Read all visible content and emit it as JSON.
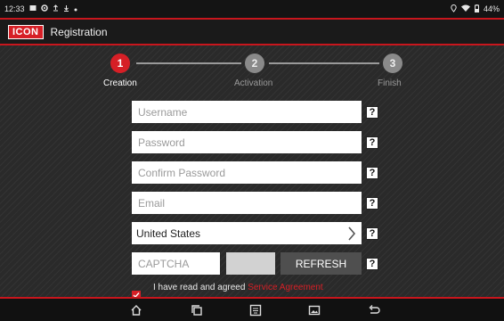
{
  "status_bar": {
    "time": "12:33",
    "battery": "44%"
  },
  "app_bar": {
    "logo_text": "ICON",
    "title": "Registration"
  },
  "steps": [
    {
      "number": "1",
      "label": "Creation",
      "active": true
    },
    {
      "number": "2",
      "label": "Activation",
      "active": false
    },
    {
      "number": "3",
      "label": "Finish",
      "active": false
    }
  ],
  "form": {
    "username_placeholder": "Username",
    "password_placeholder": "Password",
    "confirm_password_placeholder": "Confirm Password",
    "email_placeholder": "Email",
    "country_value": "United States",
    "captcha_placeholder": "CAPTCHA",
    "refresh_label": "REFRESH",
    "help_label": "?"
  },
  "agreement": {
    "text": "I have read and agreed",
    "link_text": "Service Agreement",
    "checked": true
  },
  "colors": {
    "accent": "#d61f26",
    "inactive_step": "#8a8a8a",
    "background": "#2a2a2a"
  }
}
